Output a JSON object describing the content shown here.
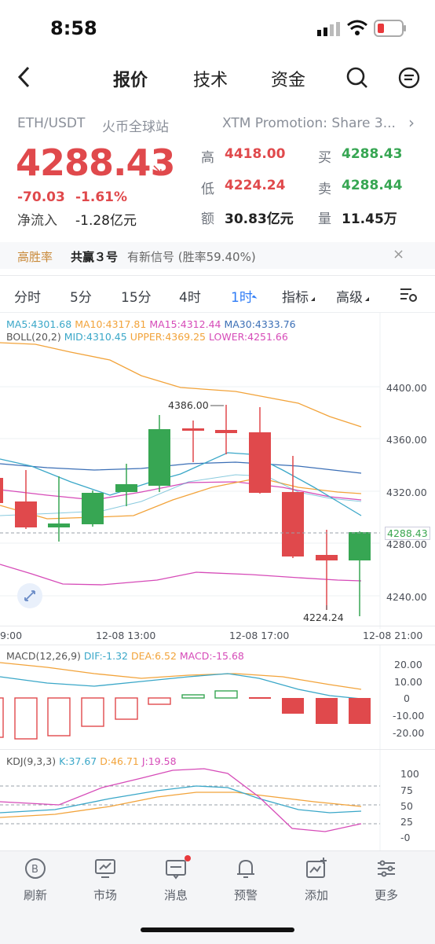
{
  "status_bar": {
    "time": "8:58"
  },
  "nav": {
    "tabs": [
      {
        "label": "报价"
      },
      {
        "label": "技术"
      },
      {
        "label": "资金"
      }
    ]
  },
  "quote": {
    "pair": "ETH/USDT",
    "exchange": "火币全球站",
    "promo": "XTM Promotion: Share 3...",
    "price": "4288.43",
    "change": "-70.03",
    "change_pct": "-1.61%",
    "net_inflow_label": "净流入",
    "net_inflow_value": "-1.28亿元",
    "stats": {
      "high_label": "高",
      "high": "4418.00",
      "low_label": "低",
      "low": "4224.24",
      "amount_label": "额",
      "amount": "30.83亿元",
      "bid_label": "买",
      "bid": "4288.43",
      "ask_label": "卖",
      "ask": "4288.44",
      "volume_label": "量",
      "volume": "11.45万"
    }
  },
  "signal_banner": {
    "tag": "高胜率",
    "name": "共赢３号",
    "text": "有新信号 (胜率59.40%)"
  },
  "period_tabs": {
    "items": [
      {
        "label": "分时"
      },
      {
        "label": "5分"
      },
      {
        "label": "15分"
      },
      {
        "label": "4时"
      },
      {
        "label": "1时"
      },
      {
        "label": "指标"
      },
      {
        "label": "高级"
      }
    ]
  },
  "main_chart": {
    "ma_legend": {
      "ma5": "MA5:4301.68",
      "ma10": "MA10:4317.81",
      "ma15": "MA15:4312.44",
      "ma30": "MA30:4333.76"
    },
    "boll_legend": {
      "boll": "BOLL(20,2)",
      "mid": "MID:4310.45",
      "upper": "UPPER:4369.25",
      "lower": "LOWER:4251.66"
    },
    "y_ticks": [
      "4400.00",
      "4360.00",
      "4320.00",
      "4280.00",
      "4240.00"
    ],
    "current_price_tag": "4288.43",
    "high_annotation": "4386.00",
    "low_annotation": "4224.24",
    "x_ticks": [
      "9:00",
      "12-08 13:00",
      "12-08 17:00",
      "12-08 21:00"
    ]
  },
  "macd": {
    "legend": {
      "name": "MACD(12,26,9)",
      "dif": "DIF:-1.32",
      "dea": "DEA:6.52",
      "macd": "MACD:-15.68"
    },
    "y_ticks": [
      "20.00",
      "10.00",
      "0",
      "-10.00",
      "-20.00"
    ]
  },
  "kdj": {
    "legend": {
      "name": "KDJ(9,3,3)",
      "k": "K:37.67",
      "d": "D:46.71",
      "j": "J:19.58"
    },
    "y_ticks": [
      "100",
      "75",
      "50",
      "25",
      "-0"
    ]
  },
  "bottom_bar": {
    "items": [
      {
        "label": "刷新",
        "icon": "refresh-icon"
      },
      {
        "label": "市场",
        "icon": "market-icon"
      },
      {
        "label": "消息",
        "icon": "message-icon"
      },
      {
        "label": "预警",
        "icon": "bell-icon"
      },
      {
        "label": "添加",
        "icon": "add-icon"
      },
      {
        "label": "更多",
        "icon": "more-icon"
      }
    ]
  },
  "colors": {
    "up": "#37a653",
    "down": "#e0494c",
    "accent": "#2f7cf6",
    "ma5": "#3aa7c8",
    "ma10": "#f2a33a",
    "ma15": "#d64bb8",
    "ma30": "#3b6fb6"
  }
}
